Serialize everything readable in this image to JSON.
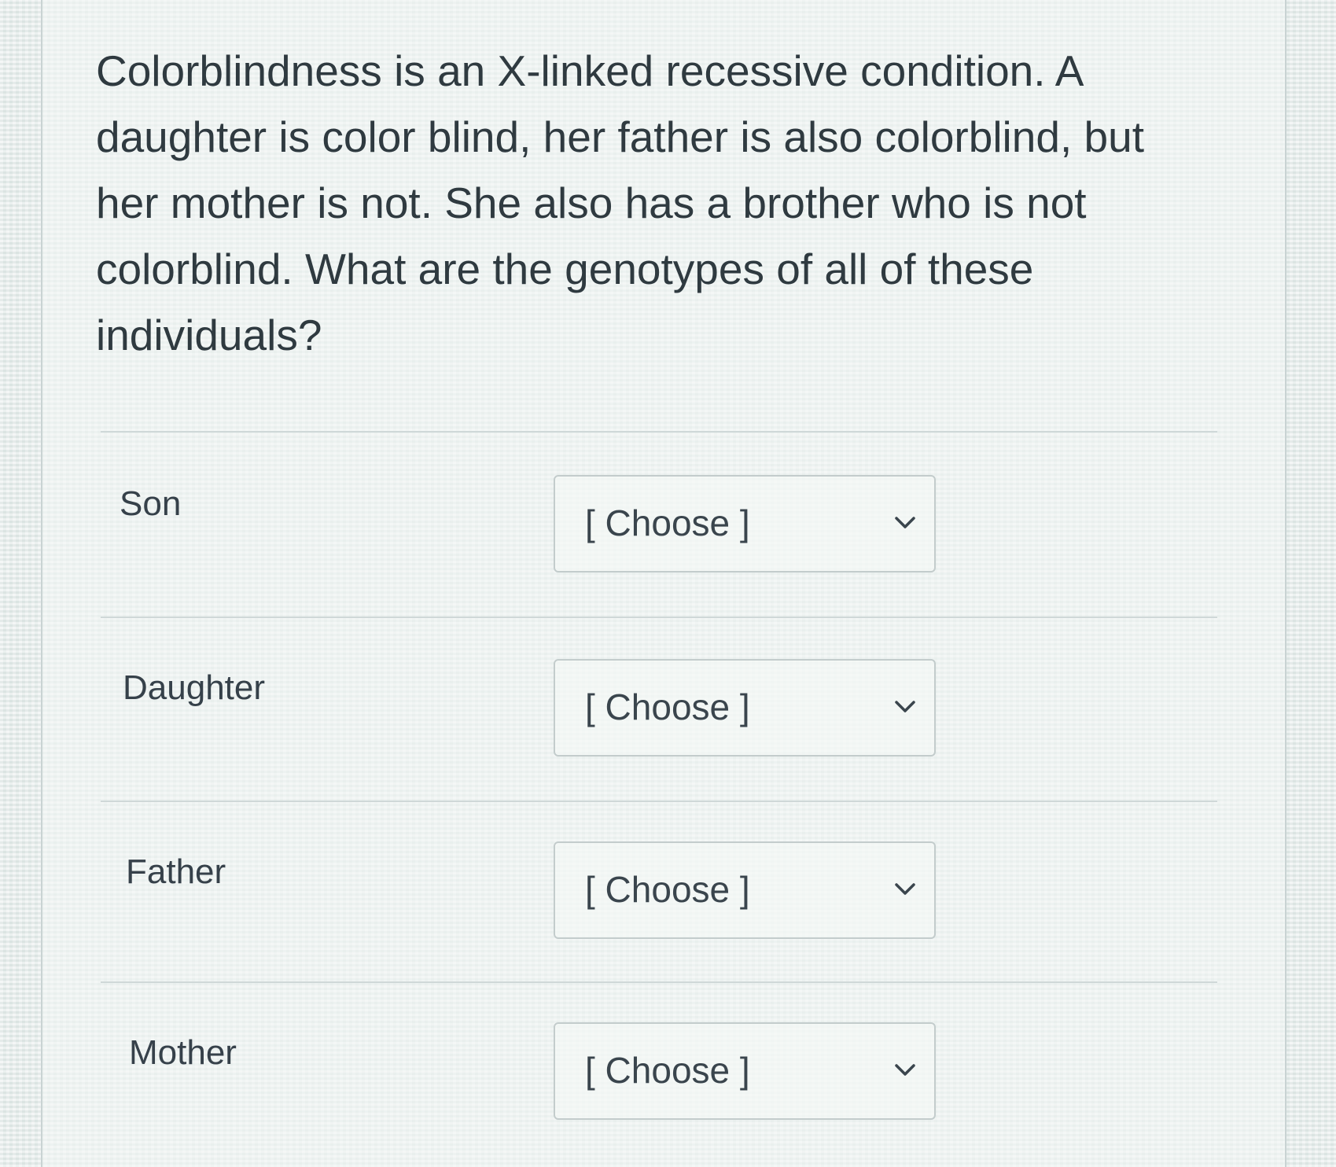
{
  "question": {
    "text": "Colorblindness is an X-linked recessive condition. A daughter is color blind, her father is also colorblind, but her mother is not. She also has a brother who is not colorblind. What are the genotypes of all of these individuals?"
  },
  "answers": [
    {
      "label": "Son",
      "selected": "[ Choose ]",
      "icon": "chevron-down-icon"
    },
    {
      "label": "Daughter",
      "selected": "[ Choose ]",
      "icon": "chevron-down-icon"
    },
    {
      "label": "Father",
      "selected": "[ Choose ]",
      "icon": "chevron-down-icon"
    },
    {
      "label": "Mother",
      "selected": "[ Choose ]",
      "icon": "chevron-down-icon"
    }
  ]
}
